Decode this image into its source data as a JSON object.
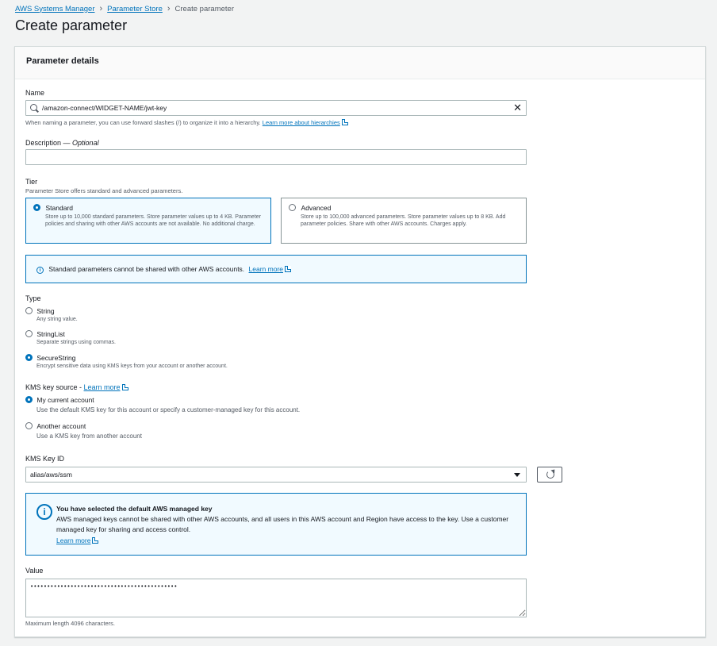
{
  "breadcrumb": {
    "items": [
      "AWS Systems Manager",
      "Parameter Store"
    ],
    "current": "Create parameter"
  },
  "page_title": "Create parameter",
  "panel_title": "Parameter details",
  "name": {
    "label": "Name",
    "value": "/amazon-connect/WIDGET-NAME/jwt-key",
    "hint": "When naming a parameter, you can use forward slashes (/) to organize it into a hierarchy.",
    "hint_link": "Learn more about hierarchies"
  },
  "description": {
    "label": "Description",
    "optional": "Optional",
    "value": ""
  },
  "tier": {
    "label": "Tier",
    "desc": "Parameter Store offers standard and advanced parameters.",
    "options": [
      {
        "title": "Standard",
        "body": "Store up to 10,000 standard parameters. Store parameter values up to 4 KB. Parameter policies and sharing with other AWS accounts are not available. No additional charge.",
        "selected": true
      },
      {
        "title": "Advanced",
        "body": "Store up to 100,000 advanced parameters. Store parameter values up to 8 KB. Add parameter policies. Share with other AWS accounts. Charges apply.",
        "selected": false
      }
    ],
    "info_text": "Standard parameters cannot be shared with other AWS accounts.",
    "info_link": "Learn more"
  },
  "type": {
    "label": "Type",
    "options": [
      {
        "title": "String",
        "desc": "Any string value.",
        "selected": false
      },
      {
        "title": "StringList",
        "desc": "Separate strings using commas.",
        "selected": false
      },
      {
        "title": "SecureString",
        "desc": "Encrypt sensitive data using KMS keys from your account or another account.",
        "selected": true
      }
    ]
  },
  "kms_source": {
    "label": "KMS key source - ",
    "link": "Learn more",
    "options": [
      {
        "title": "My current account",
        "desc": "Use the default KMS key for this account or specify a customer-managed key for this account.",
        "selected": true
      },
      {
        "title": "Another account",
        "desc": "Use a KMS key from another account",
        "selected": false
      }
    ]
  },
  "kms_key": {
    "label": "KMS Key ID",
    "value": "alias/aws/ssm",
    "info_title": "You have selected the default AWS managed key",
    "info_body": "AWS managed keys cannot be shared with other AWS accounts, and all users in this AWS account and Region have access to the key. Use a customer managed key for sharing and access control.",
    "info_link": "Learn more"
  },
  "value": {
    "label": "Value",
    "content": "••••••••••••••••••••••••••••••••••••••••••••",
    "hint": "Maximum length 4096 characters."
  },
  "colors": {
    "accent": "#0073bb",
    "info_bg": "#f1faff",
    "page_bg": "#f2f3f3"
  }
}
